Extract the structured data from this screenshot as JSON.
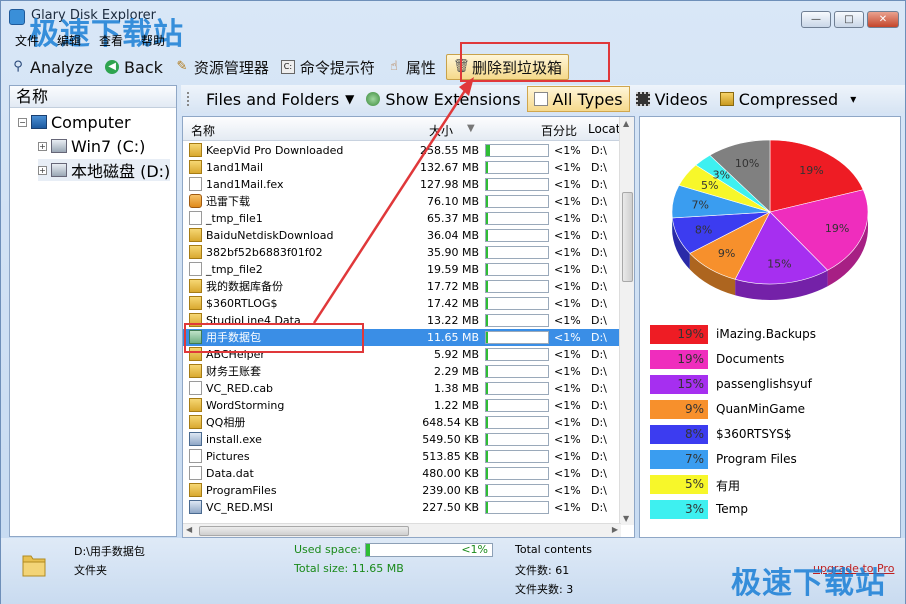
{
  "window": {
    "title": "Glary Disk Explorer",
    "min": "—",
    "max": "□",
    "close": "✕"
  },
  "watermark": {
    "top": "极速下载站",
    "bottom": "极速下载站"
  },
  "menu": [
    "文件",
    "编辑",
    "查看",
    "帮助"
  ],
  "toolbar": {
    "analyze": "Analyze",
    "back": "Back",
    "explorer": "资源管理器",
    "cmd": "命令提示符",
    "properties": "属性",
    "delete_to_trash": "删除到垃圾箱"
  },
  "tree": {
    "header": "名称",
    "computer": "Computer",
    "c_drive": "Win7 (C:)",
    "d_drive": "本地磁盘 (D:)"
  },
  "filters": {
    "files_and_folders": "Files and Folders",
    "show_extensions": "Show Extensions",
    "all_types": "All Types",
    "videos": "Videos",
    "compressed": "Compressed"
  },
  "list": {
    "columns": {
      "name": "名称",
      "size": "大小",
      "percent": "百分比",
      "location": "Locati"
    },
    "rows": [
      {
        "name": "KeepVid Pro Downloaded",
        "size": "258.55 MB",
        "pct": "<1%",
        "loc": "D:\\",
        "icon": "folder",
        "fill": 0.06
      },
      {
        "name": "1and1Mail",
        "size": "132.67 MB",
        "pct": "<1%",
        "loc": "D:\\",
        "icon": "folder",
        "fill": 0.04
      },
      {
        "name": "1and1Mail.fex",
        "size": "127.98 MB",
        "pct": "<1%",
        "loc": "D:\\",
        "icon": "file",
        "fill": 0.04
      },
      {
        "name": "迅雷下载",
        "size": "76.10 MB",
        "pct": "<1%",
        "loc": "D:\\",
        "icon": "folder-special",
        "fill": 0.03
      },
      {
        "name": "_tmp_file1",
        "size": "65.37 MB",
        "pct": "<1%",
        "loc": "D:\\",
        "icon": "file",
        "fill": 0.03
      },
      {
        "name": "BaiduNetdiskDownload",
        "size": "36.04 MB",
        "pct": "<1%",
        "loc": "D:\\",
        "icon": "folder",
        "fill": 0.03
      },
      {
        "name": "382bf52b6883f01f02",
        "size": "35.90 MB",
        "pct": "<1%",
        "loc": "D:\\",
        "icon": "folder",
        "fill": 0.03
      },
      {
        "name": "_tmp_file2",
        "size": "19.59 MB",
        "pct": "<1%",
        "loc": "D:\\",
        "icon": "file",
        "fill": 0.03
      },
      {
        "name": "我的数据库备份",
        "size": "17.72 MB",
        "pct": "<1%",
        "loc": "D:\\",
        "icon": "folder",
        "fill": 0.03
      },
      {
        "name": "$360RTLOG$",
        "size": "17.42 MB",
        "pct": "<1%",
        "loc": "D:\\",
        "icon": "folder",
        "fill": 0.03
      },
      {
        "name": "StudioLine4 Data",
        "size": "13.22 MB",
        "pct": "<1%",
        "loc": "D:\\",
        "icon": "folder",
        "fill": 0.03
      },
      {
        "name": "用手数据包",
        "size": "11.65 MB",
        "pct": "<1%",
        "loc": "D:\\",
        "icon": "folder-open",
        "fill": 0.03,
        "selected": true
      },
      {
        "name": "ABCHelper",
        "size": "5.92 MB",
        "pct": "<1%",
        "loc": "D:\\",
        "icon": "folder",
        "fill": 0.03
      },
      {
        "name": "财务王账套",
        "size": "2.29 MB",
        "pct": "<1%",
        "loc": "D:\\",
        "icon": "folder",
        "fill": 0.03
      },
      {
        "name": "VC_RED.cab",
        "size": "1.38 MB",
        "pct": "<1%",
        "loc": "D:\\",
        "icon": "file",
        "fill": 0.03
      },
      {
        "name": "WordStorming",
        "size": "1.22 MB",
        "pct": "<1%",
        "loc": "D:\\",
        "icon": "folder",
        "fill": 0.03
      },
      {
        "name": "QQ相册",
        "size": "648.54 KB",
        "pct": "<1%",
        "loc": "D:\\",
        "icon": "folder",
        "fill": 0.03
      },
      {
        "name": "install.exe",
        "size": "549.50 KB",
        "pct": "<1%",
        "loc": "D:\\",
        "icon": "exe",
        "fill": 0.03
      },
      {
        "name": "Pictures",
        "size": "513.85 KB",
        "pct": "<1%",
        "loc": "D:\\",
        "icon": "file",
        "fill": 0.03
      },
      {
        "name": "Data.dat",
        "size": "480.00 KB",
        "pct": "<1%",
        "loc": "D:\\",
        "icon": "file",
        "fill": 0.03
      },
      {
        "name": "ProgramFiles",
        "size": "239.00 KB",
        "pct": "<1%",
        "loc": "D:\\",
        "icon": "folder",
        "fill": 0.03
      },
      {
        "name": "VC_RED.MSI",
        "size": "227.50 KB",
        "pct": "<1%",
        "loc": "D:\\",
        "icon": "exe",
        "fill": 0.03
      }
    ]
  },
  "chart_data": {
    "type": "pie",
    "slices": [
      {
        "label": "iMazing.Backups",
        "value": 19,
        "pct_label": "19%",
        "color": "#ee1c24"
      },
      {
        "label": "Documents",
        "value": 19,
        "pct_label": "19%",
        "color": "#ef2dbd"
      },
      {
        "label": "passenglishsyuf",
        "value": 15,
        "pct_label": "15%",
        "color": "#a62ff0"
      },
      {
        "label": "QuanMinGame",
        "value": 9,
        "pct_label": "9%",
        "color": "#f7902c"
      },
      {
        "label": "$360RTSYS$",
        "value": 8,
        "pct_label": "8%",
        "color": "#3c3cf0"
      },
      {
        "label": "Program Files",
        "value": 7,
        "pct_label": "7%",
        "color": "#3a9df0"
      },
      {
        "label": "有用",
        "value": 5,
        "pct_label": "5%",
        "color": "#f7f72a"
      },
      {
        "label": "Temp",
        "value": 3,
        "pct_label": "3%",
        "color": "#3ef0f0"
      },
      {
        "label": "",
        "value": 10,
        "pct_label": "10%",
        "color": "#808080"
      }
    ]
  },
  "status": {
    "path": "D:\\用手数据包",
    "kind": "文件夹",
    "used_space_label": "Used space:",
    "used_pct": "<1%",
    "used_fill": 0.03,
    "total_size": "Total size: 11.65 MB",
    "total_contents": "Total contents",
    "file_count": "文件数: 61",
    "folder_count": "文件夹数: 3",
    "upgrade": "upgrade to Pro"
  }
}
